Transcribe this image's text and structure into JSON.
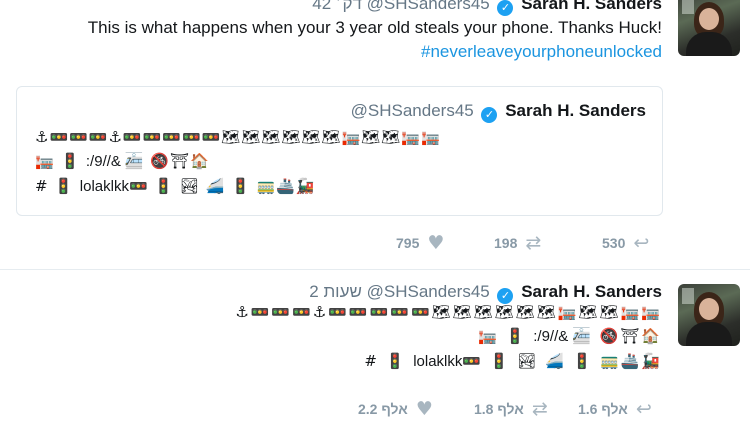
{
  "tweet1": {
    "name": "Sarah H. Sanders",
    "handle": "@SHSanders45",
    "time": "42 דק׳",
    "text_line1": "This is what happens when your 3 year old steals your phone. Thanks Huck!",
    "hashtag": "#neverleaveyourphoneunlocked",
    "quoted": {
      "handle": "@SHSanders45",
      "name": "Sarah H. Sanders",
      "line1": "⚓🚥🚥🚥⚓🚥🚥🚥🚥🚥🗺🗺🗺🗺🗺🗺🏣🗺🗺🏣🏣",
      "line2_prefix": "🏣 🚦 ",
      "line2_text": ":/9//&",
      "line2_suffix": "🚈 🚳⛩🏠",
      "line3_prefix": "# 🚦 ",
      "line3_text": "lolaklkk",
      "line3_suffix": "🚥 🚦 🏞 🚄 🚦 🚃🚢🚂"
    },
    "actions": {
      "likes": "795",
      "retweets": "198",
      "replies": "530"
    },
    "icons": {
      "like": "heart-icon",
      "retweet": "retweet-icon",
      "reply": "reply-icon"
    }
  },
  "tweet2": {
    "name": "Sarah H. Sanders",
    "handle": "@SHSanders45",
    "time": "2 שעות",
    "line1": "⚓🚥🚥🚥⚓🚥🚥🚥🚥🚥🗺🗺🗺🗺🗺🗺🏣🗺🗺🏣🏣",
    "line2_prefix": "🏣 🚦 ",
    "line2_text": ":/9//&",
    "line2_suffix": "🚈 🚳⛩🏠",
    "line3_prefix": "# 🚦 ",
    "line3_text": "lolaklkk",
    "line3_suffix": "🚥 🚦 🏞 🚄 🚦 🚃🚢🚂",
    "actions": {
      "likes": "2.2 אלף",
      "retweets": "1.8 אלף",
      "replies": "1.6 אלף"
    }
  },
  "colors": {
    "link": "#1b95e0",
    "muted": "#657786",
    "verified": "#1da1f2"
  }
}
